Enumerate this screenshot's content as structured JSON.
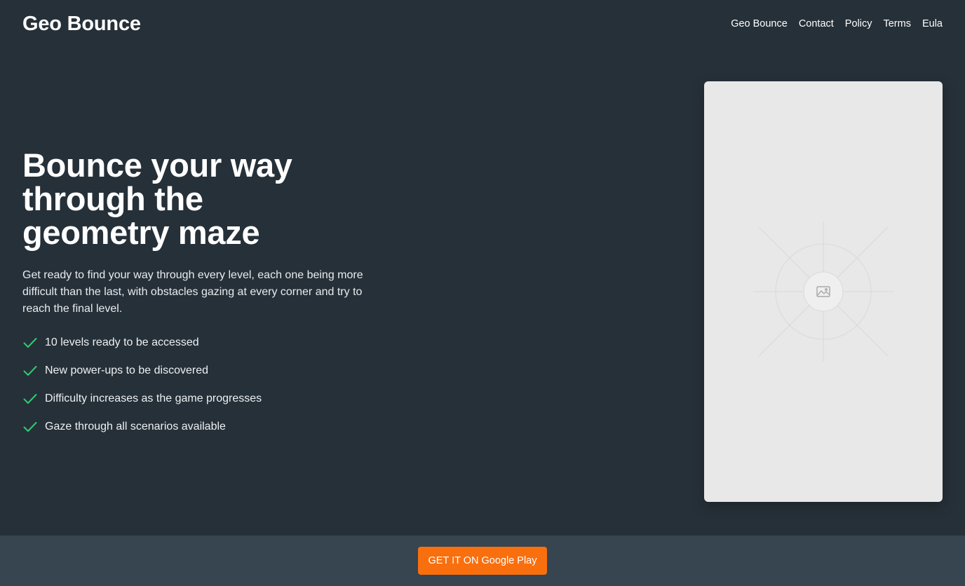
{
  "header": {
    "brand": "Geo Bounce",
    "nav": [
      {
        "label": "Geo Bounce",
        "name": "nav-link-geo-bounce"
      },
      {
        "label": "Contact",
        "name": "nav-link-contact"
      },
      {
        "label": "Policy",
        "name": "nav-link-policy"
      },
      {
        "label": "Terms",
        "name": "nav-link-terms"
      },
      {
        "label": "Eula",
        "name": "nav-link-eula"
      }
    ]
  },
  "hero": {
    "title": "Bounce your way through the geometry maze",
    "description": "Get ready to find your way through every level, each one being more difficult than the last, with obstacles gazing at every corner and try to reach the final level.",
    "features": [
      "10 levels ready to be accessed",
      "New power-ups to be discovered",
      "Difficulty increases as the game progresses",
      "Gaze through all scenarios available"
    ],
    "feature_icon": "check-icon",
    "media_icon": "image-placeholder-icon"
  },
  "cta": {
    "label": "GET IT ON Google Play"
  },
  "colors": {
    "background": "#263038",
    "footer": "#36454f",
    "accent": "#f96f0e",
    "check": "#2ecc71",
    "placeholder": "#e8e8e8"
  }
}
